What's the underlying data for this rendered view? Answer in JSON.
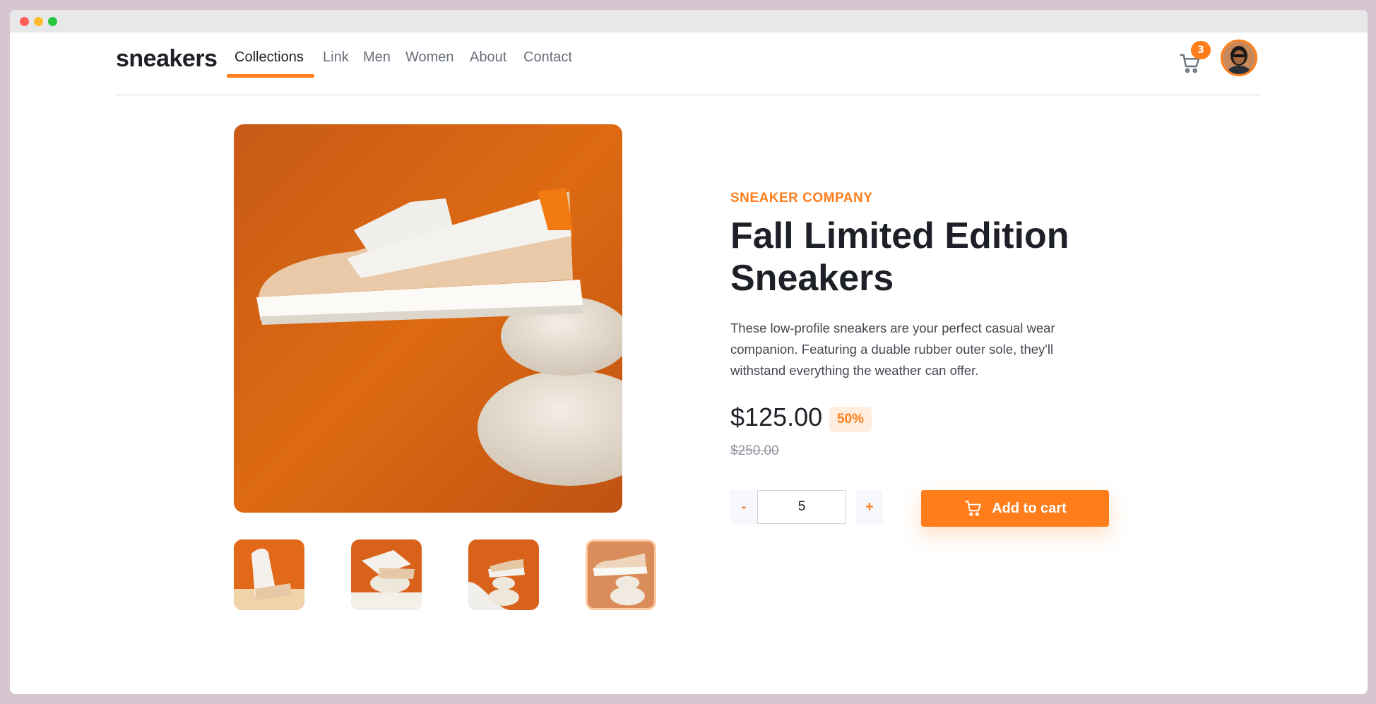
{
  "brand": {
    "logo": "sneakers",
    "accent_color": "#ff7e1b"
  },
  "nav": {
    "links": [
      "Collections",
      "Link",
      "Men",
      "Women",
      "About",
      "Contact"
    ],
    "active": "Collections"
  },
  "cart": {
    "icon": "cart-icon",
    "count": "3"
  },
  "user": {
    "avatar": "avatar"
  },
  "gallery": {
    "thumbnails": [
      "thumbnail-1",
      "thumbnail-2",
      "thumbnail-3",
      "thumbnail-4"
    ],
    "selected_thumbnail": 4
  },
  "product": {
    "company": "SNEAKER COMPANY",
    "title": "Fall Limited Edition Sneakers",
    "description": "These low-profile sneakers are your perfect casual wear companion. Featuring a duable rubber outer sole, they'll withstand everything the weather can offer.",
    "price": "$125.00",
    "discount": "50%",
    "original_price": "$250.00"
  },
  "quantity": {
    "minus_label": "-",
    "value": "5",
    "plus_label": "+"
  },
  "actions": {
    "add_to_cart": "Add to cart"
  }
}
